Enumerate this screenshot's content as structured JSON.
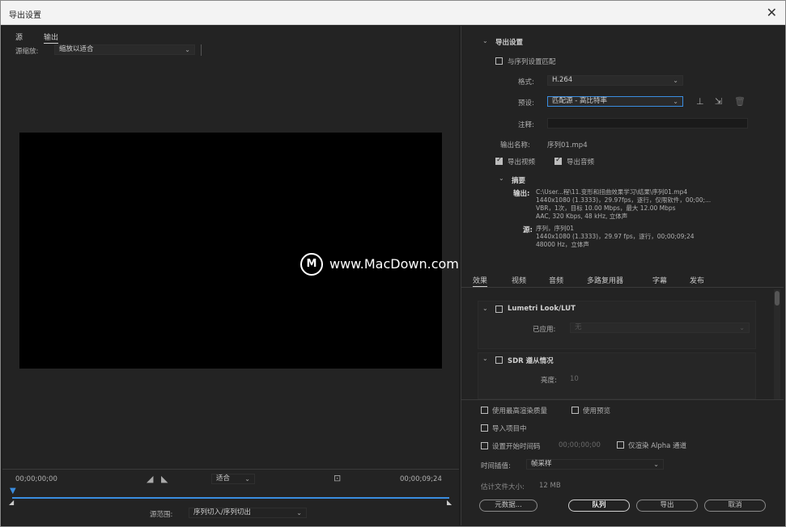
{
  "window": {
    "title": "导出设置",
    "close_glyph": "✕"
  },
  "left": {
    "tabs": [
      "源",
      "输出"
    ],
    "scale_label": "源缩放:",
    "scale_value": "缩放以适合",
    "timecode_start": "00;00;00;00",
    "fit_value": "适合",
    "timecode_end": "00;00;09;24",
    "source_range_label": "源范围:",
    "source_range_value": "序列切入/序列切出"
  },
  "export_settings": {
    "section_title": "导出设置",
    "match_sequence_label": "与序列设置匹配",
    "format_label": "格式:",
    "format_value": "H.264",
    "preset_label": "预设:",
    "preset_value": "匹配源 - 高比特率",
    "comment_label": "注释:",
    "output_name_label": "输出名称:",
    "output_name_value": "序列01.mp4",
    "export_video_label": "导出视频",
    "export_audio_label": "导出音频",
    "summary_title": "摘要",
    "summary_output_label": "输出:",
    "summary_output_lines": [
      "C:\\User...程\\11.变形和扭曲效果学习\\结果\\序列01.mp4",
      "1440x1080 (1.3333)，29.97fps，逐行，仅限软件，00;00;...",
      "VBR，1次，目标 10.00 Mbps，最大 12.00 Mbps",
      "AAC, 320 Kbps, 48 kHz, 立体声"
    ],
    "summary_source_label": "源:",
    "summary_source_lines": [
      "序列，序列01",
      "1440x1080 (1.3333)，29.97 fps，逐行，00;00;09;24",
      "48000 Hz，立体声"
    ]
  },
  "tabs2": [
    "效果",
    "视频",
    "音频",
    "多路复用器",
    "字幕",
    "发布"
  ],
  "effects": {
    "lumetri_label": "Lumetri Look/LUT",
    "applied_label": "已应用:",
    "applied_value": "无",
    "sdr_label": "SDR 遵从情况",
    "brightness_label": "亮度:",
    "brightness_value": "10"
  },
  "options": {
    "max_quality_label": "使用最高渲染质量",
    "use_preview_label": "使用预览",
    "import_project_label": "导入项目中",
    "start_timecode_label": "设置开始时间码",
    "start_timecode_value": "00;00;00;00",
    "alpha_label": "仅渲染 Alpha 通道",
    "interp_label": "时间插值:",
    "interp_value": "帧采样",
    "filesize_label": "估计文件大小:",
    "filesize_value": "12 MB"
  },
  "buttons": {
    "metadata": "元数据...",
    "queue": "队列",
    "export": "导出",
    "cancel": "取消"
  },
  "watermark": {
    "logo_glyph": "M",
    "text": "www.MacDown.com"
  }
}
